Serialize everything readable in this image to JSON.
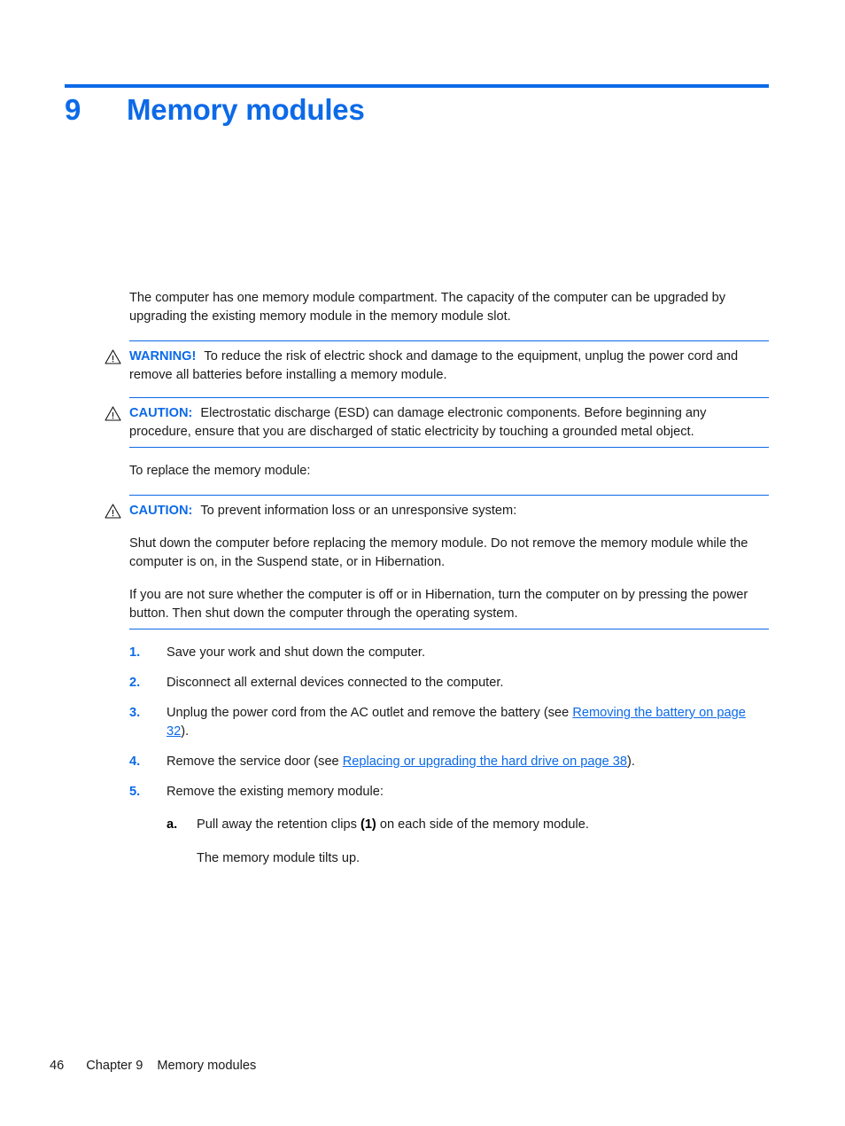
{
  "colors": {
    "accent": "#0c6ae8",
    "text": "#1a1a1a",
    "link": "#0c6ae8"
  },
  "chapter": {
    "number": "9",
    "title": "Memory modules"
  },
  "intro": {
    "paragraph": "The computer has one memory module compartment. The capacity of the computer can be upgraded by upgrading the existing memory module in the memory module slot."
  },
  "notices": [
    {
      "icon": "warning-triangle-icon",
      "label": "WARNING!",
      "text": "To reduce the risk of electric shock and damage to the equipment, unplug the power cord and remove all batteries before installing a memory module."
    },
    {
      "icon": "warning-triangle-icon",
      "label": "CAUTION:",
      "text": "Electrostatic discharge (ESD) can damage electronic components. Before beginning any procedure, ensure that you are discharged of static electricity by touching a grounded metal object."
    }
  ],
  "lead_in": "To replace the memory module:",
  "caution_block": {
    "icon": "warning-triangle-icon",
    "label": "CAUTION:",
    "text": "To prevent information loss or an unresponsive system:",
    "paragraphs": [
      "Shut down the computer before replacing the memory module. Do not remove the memory module while the computer is on, in the Suspend state, or in Hibernation.",
      "If you are not sure whether the computer is off or in Hibernation, turn the computer on by pressing the power button. Then shut down the computer through the operating system."
    ]
  },
  "steps": [
    {
      "marker": "1.",
      "text": "Save your work and shut down the computer."
    },
    {
      "marker": "2.",
      "text": "Disconnect all external devices connected to the computer."
    },
    {
      "marker": "3.",
      "text_before": "Unplug the power cord from the AC outlet and remove the battery (see ",
      "link": "Removing the battery on page 32",
      "text_after": ")."
    },
    {
      "marker": "4.",
      "text_before": "Remove the service door (see ",
      "link": "Replacing or upgrading the hard drive on page 38",
      "text_after": ")."
    },
    {
      "marker": "5.",
      "text": "Remove the existing memory module:",
      "substeps": [
        {
          "marker": "a.",
          "text_before": "Pull away the retention clips ",
          "bold": "(1)",
          "text_after": " on each side of the memory module."
        }
      ],
      "subnote": "The memory module tilts up."
    }
  ],
  "footer": {
    "page_number": "46",
    "chapter_label": "Chapter 9",
    "chapter_title": "Memory modules"
  }
}
